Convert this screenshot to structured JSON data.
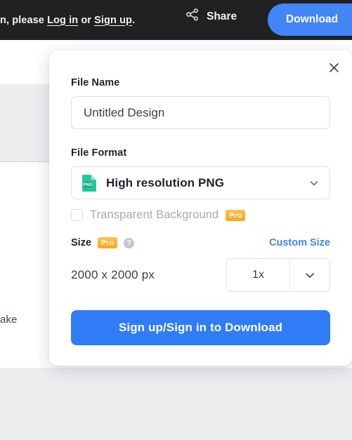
{
  "topbar": {
    "notice_prefix": "n, please ",
    "login_link": "Log in",
    "notice_middle": " or ",
    "signup_link": "Sign up",
    "notice_suffix": ".",
    "share_label": "Share",
    "share_icon": "share-nodes-icon",
    "download_label": "Download",
    "background_color": "#212124",
    "accent_color": "#4285f4"
  },
  "canvas": {
    "fragment_text": "ake"
  },
  "modal": {
    "close_icon": "close-icon",
    "file_name": {
      "label": "File Name",
      "value": "Untitled Design",
      "placeholder": "Untitled Design"
    },
    "file_format": {
      "label": "File Format",
      "selected": "High resolution PNG",
      "icon": "png-file-icon",
      "icon_text": "PNG",
      "chevron_icon": "chevron-down-icon"
    },
    "transparent_background": {
      "label": "Transparent Background",
      "checked": false,
      "badge": "Pro"
    },
    "size": {
      "label": "Size",
      "badge": "Pro",
      "help_icon": "help-circle-icon",
      "help_glyph": "?",
      "custom_size_link": "Custom Size",
      "dimensions": "2000 x 2000 px",
      "scale_value": "1x",
      "scale_chevron_icon": "chevron-down-icon"
    },
    "cta_label": "Sign up/Sign in to Download",
    "pro_badge_color": "#fba621",
    "cta_color": "#2f7cf6",
    "link_color": "#4285f4"
  }
}
